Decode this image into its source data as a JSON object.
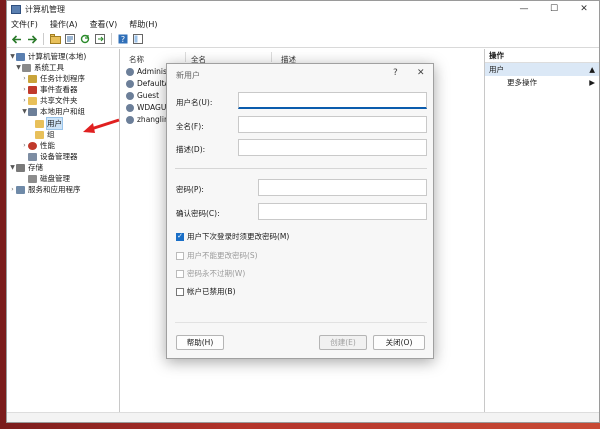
{
  "window": {
    "title": "计算机管理",
    "controls": {
      "minimize": "—",
      "maximize": "☐",
      "close": "✕"
    }
  },
  "menu": [
    "文件(F)",
    "操作(A)",
    "查看(V)",
    "帮助(H)"
  ],
  "toolbar": {
    "buttons": [
      "back-arrow",
      "forward-arrow",
      "up-folder",
      "properties",
      "refresh",
      "export-list",
      "help",
      "console-tree"
    ]
  },
  "tree": {
    "root": "计算机管理(本地)",
    "system_tools": "系统工具",
    "task_scheduler": "任务计划程序",
    "event_viewer": "事件查看器",
    "shared_folders": "共享文件夹",
    "local_users_groups": "本地用户和组",
    "users": "用户",
    "groups": "组",
    "performance": "性能",
    "device_manager": "设备管理器",
    "storage": "存储",
    "disk_management": "磁盘管理",
    "services_apps": "服务和应用程序"
  },
  "list": {
    "columns": [
      "名称",
      "全名",
      "描述"
    ],
    "users": [
      "Administr",
      "DefaultAc",
      "Guest",
      "WDAGUtil",
      "zhanglin"
    ]
  },
  "actions": {
    "header": "操作",
    "section": "用户",
    "more": "更多操作",
    "section_arrow": "▲",
    "more_arrow": "▶"
  },
  "dialog": {
    "title": "新用户",
    "help_glyph": "?",
    "close_glyph": "✕",
    "username_label": "用户名(U):",
    "fullname_label": "全名(F):",
    "description_label": "描述(D):",
    "password_label": "密码(P):",
    "confirm_label": "确认密码(C):",
    "must_change": "用户下次登录时须更改密码(M)",
    "cannot_change": "用户不能更改密码(S)",
    "never_expires": "密码永不过期(W)",
    "disabled": "帐户已禁用(B)",
    "help_button": "帮助(H)",
    "create_button": "创建(E)",
    "close_button": "关闭(O)",
    "username_value": "",
    "fullname_value": "",
    "description_value": "",
    "password_value": "",
    "confirm_value": ""
  },
  "colors": {
    "accent": "#1a6fc7",
    "selection": "#cde3f7",
    "arrow": "#e02020"
  }
}
